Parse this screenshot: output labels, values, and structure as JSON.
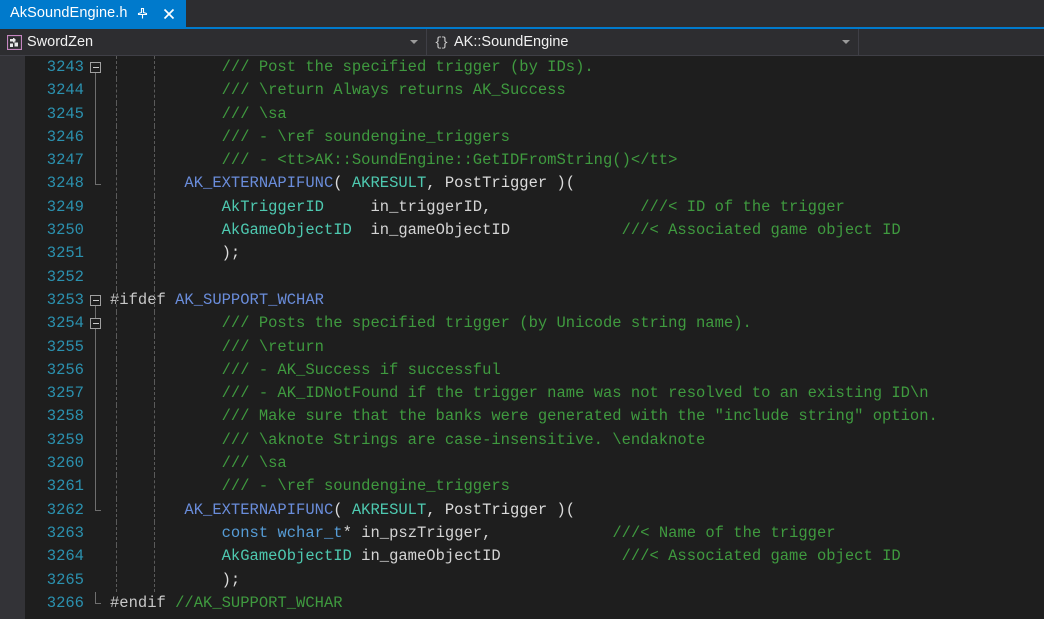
{
  "tab": {
    "title": "AkSoundEngine.h",
    "pin_icon": "pin-icon",
    "close_icon": "close-icon"
  },
  "navbar": {
    "project": "SwordZen",
    "project_icon": "project-icon",
    "scope": "AK::SoundEngine",
    "scope_icon": "namespace-braces-icon",
    "member": "",
    "dropdown_icon": "chevron-down-icon"
  },
  "editor": {
    "first_line_number": 3243,
    "lines": [
      {
        "n": "3243",
        "fold": "open",
        "guide": "start",
        "tokens": [
          {
            "t": "            ",
            "c": "plain"
          },
          {
            "t": "/// Post the specified trigger (by IDs).",
            "c": "cmt"
          }
        ]
      },
      {
        "n": "3244",
        "fold": "none",
        "guide": "mid",
        "tokens": [
          {
            "t": "            ",
            "c": "plain"
          },
          {
            "t": "/// \\return Always returns AK_Success",
            "c": "cmt"
          }
        ]
      },
      {
        "n": "3245",
        "fold": "none",
        "guide": "mid",
        "tokens": [
          {
            "t": "            ",
            "c": "plain"
          },
          {
            "t": "/// \\sa",
            "c": "cmt"
          }
        ]
      },
      {
        "n": "3246",
        "fold": "none",
        "guide": "mid",
        "tokens": [
          {
            "t": "            ",
            "c": "plain"
          },
          {
            "t": "/// - \\ref soundengine_triggers",
            "c": "cmt"
          }
        ]
      },
      {
        "n": "3247",
        "fold": "none",
        "guide": "mid",
        "tokens": [
          {
            "t": "            ",
            "c": "plain"
          },
          {
            "t": "/// - <tt>AK::SoundEngine::GetIDFromString()</tt>",
            "c": "cmt"
          }
        ]
      },
      {
        "n": "3248",
        "fold": "none",
        "guide": "end",
        "tokens": [
          {
            "t": "        ",
            "c": "plain"
          },
          {
            "t": "AK_EXTERNAPIFUNC",
            "c": "mac"
          },
          {
            "t": "( ",
            "c": "plain"
          },
          {
            "t": "AKRESULT",
            "c": "typ"
          },
          {
            "t": ", PostTrigger )(",
            "c": "plain"
          }
        ]
      },
      {
        "n": "3249",
        "fold": "none",
        "guide": "none",
        "tokens": [
          {
            "t": "            ",
            "c": "plain"
          },
          {
            "t": "AkTriggerID",
            "c": "typ"
          },
          {
            "t": "     ",
            "c": "plain"
          },
          {
            "t": "in_triggerID,",
            "c": "id"
          },
          {
            "t": "                ",
            "c": "plain"
          },
          {
            "t": "///< ID of the trigger",
            "c": "cmt"
          }
        ]
      },
      {
        "n": "3250",
        "fold": "none",
        "guide": "none",
        "tokens": [
          {
            "t": "            ",
            "c": "plain"
          },
          {
            "t": "AkGameObjectID",
            "c": "typ"
          },
          {
            "t": "  ",
            "c": "plain"
          },
          {
            "t": "in_gameObjectID",
            "c": "id"
          },
          {
            "t": "            ",
            "c": "plain"
          },
          {
            "t": "///< Associated game object ID",
            "c": "cmt"
          }
        ]
      },
      {
        "n": "3251",
        "fold": "none",
        "guide": "none",
        "tokens": [
          {
            "t": "            );",
            "c": "plain"
          }
        ]
      },
      {
        "n": "3252",
        "fold": "none",
        "guide": "none",
        "tokens": []
      },
      {
        "n": "3253",
        "fold": "open",
        "guide": "start",
        "tokens": [
          {
            "t": "#ifdef ",
            "c": "ppd"
          },
          {
            "t": "AK_SUPPORT_WCHAR",
            "c": "mac"
          }
        ]
      },
      {
        "n": "3254",
        "fold": "open",
        "guide": "mid",
        "tokens": [
          {
            "t": "            ",
            "c": "plain"
          },
          {
            "t": "/// Posts the specified trigger (by Unicode string name).",
            "c": "cmt"
          }
        ]
      },
      {
        "n": "3255",
        "fold": "none",
        "guide": "mid",
        "tokens": [
          {
            "t": "            ",
            "c": "plain"
          },
          {
            "t": "/// \\return",
            "c": "cmt"
          }
        ]
      },
      {
        "n": "3256",
        "fold": "none",
        "guide": "mid",
        "tokens": [
          {
            "t": "            ",
            "c": "plain"
          },
          {
            "t": "/// - AK_Success if successful",
            "c": "cmt"
          }
        ]
      },
      {
        "n": "3257",
        "fold": "none",
        "guide": "mid",
        "tokens": [
          {
            "t": "            ",
            "c": "plain"
          },
          {
            "t": "/// - AK_IDNotFound if the trigger name was not resolved to an existing ID\\n",
            "c": "cmt"
          }
        ]
      },
      {
        "n": "3258",
        "fold": "none",
        "guide": "mid",
        "tokens": [
          {
            "t": "            ",
            "c": "plain"
          },
          {
            "t": "/// Make sure that the banks were generated with the \"include string\" option.",
            "c": "cmt"
          }
        ]
      },
      {
        "n": "3259",
        "fold": "none",
        "guide": "mid",
        "tokens": [
          {
            "t": "            ",
            "c": "plain"
          },
          {
            "t": "/// \\aknote Strings are case-insensitive. \\endaknote",
            "c": "cmt"
          }
        ]
      },
      {
        "n": "3260",
        "fold": "none",
        "guide": "mid",
        "tokens": [
          {
            "t": "            ",
            "c": "plain"
          },
          {
            "t": "/// \\sa",
            "c": "cmt"
          }
        ]
      },
      {
        "n": "3261",
        "fold": "none",
        "guide": "mid",
        "tokens": [
          {
            "t": "            ",
            "c": "plain"
          },
          {
            "t": "/// - \\ref soundengine_triggers",
            "c": "cmt"
          }
        ]
      },
      {
        "n": "3262",
        "fold": "none",
        "guide": "end",
        "tokens": [
          {
            "t": "        ",
            "c": "plain"
          },
          {
            "t": "AK_EXTERNAPIFUNC",
            "c": "mac"
          },
          {
            "t": "( ",
            "c": "plain"
          },
          {
            "t": "AKRESULT",
            "c": "typ"
          },
          {
            "t": ", PostTrigger )(",
            "c": "plain"
          }
        ]
      },
      {
        "n": "3263",
        "fold": "none",
        "guide": "none",
        "tokens": [
          {
            "t": "            ",
            "c": "plain"
          },
          {
            "t": "const",
            "c": "kw"
          },
          {
            "t": " ",
            "c": "plain"
          },
          {
            "t": "wchar_t",
            "c": "kw"
          },
          {
            "t": "* ",
            "c": "plain"
          },
          {
            "t": "in_pszTrigger,",
            "c": "id"
          },
          {
            "t": "             ",
            "c": "plain"
          },
          {
            "t": "///< Name of the trigger",
            "c": "cmt"
          }
        ]
      },
      {
        "n": "3264",
        "fold": "none",
        "guide": "none",
        "tokens": [
          {
            "t": "            ",
            "c": "plain"
          },
          {
            "t": "AkGameObjectID",
            "c": "typ"
          },
          {
            "t": " ",
            "c": "plain"
          },
          {
            "t": "in_gameObjectID",
            "c": "id"
          },
          {
            "t": "             ",
            "c": "plain"
          },
          {
            "t": "///< Associated game object ID",
            "c": "cmt"
          }
        ]
      },
      {
        "n": "3265",
        "fold": "none",
        "guide": "none",
        "tokens": [
          {
            "t": "            );",
            "c": "plain"
          }
        ]
      },
      {
        "n": "3266",
        "fold": "none",
        "guide": "close",
        "tokens": [
          {
            "t": "#endif ",
            "c": "ppd"
          },
          {
            "t": "//AK_SUPPORT_WCHAR",
            "c": "cmt"
          }
        ]
      }
    ]
  },
  "colors": {
    "accent_blue": "#007acc",
    "editor_bg": "#1e1e1e",
    "chrome_bg": "#2d2d30",
    "margin_bg": "#333337",
    "line_number": "#2b91af",
    "comment": "#3f9a3f",
    "macro": "#6a8ddb",
    "type": "#4ec9b0",
    "keyword": "#569cd6",
    "identifier": "#d4d4d4"
  }
}
